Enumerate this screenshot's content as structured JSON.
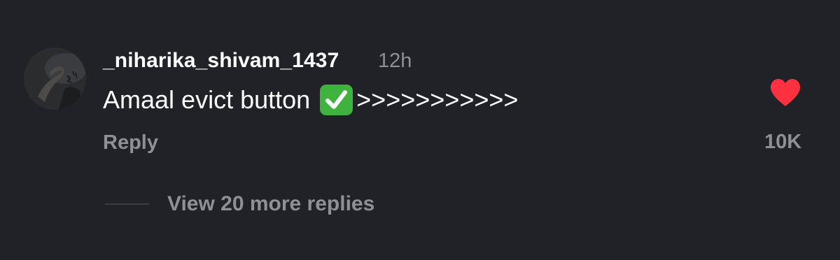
{
  "comment": {
    "username": "_niharika_shivam_1437",
    "timestamp": "12h",
    "text_before_emoji": "Amaal evict button",
    "emoji": "check-mark-button",
    "text_after_emoji": ">>>>>>>>>>>",
    "reply_label": "Reply",
    "like_count": "10K",
    "liked": true,
    "view_replies_label": "View 20 more replies"
  },
  "colors": {
    "background": "#212227",
    "primary_text": "#ffffff",
    "secondary_text": "#8d9096",
    "like_heart": "#ff3040",
    "check_emoji": "#3fb23f"
  },
  "icons": {
    "like": "heart-filled-icon",
    "emoji": "check-mark-emoji-icon"
  }
}
